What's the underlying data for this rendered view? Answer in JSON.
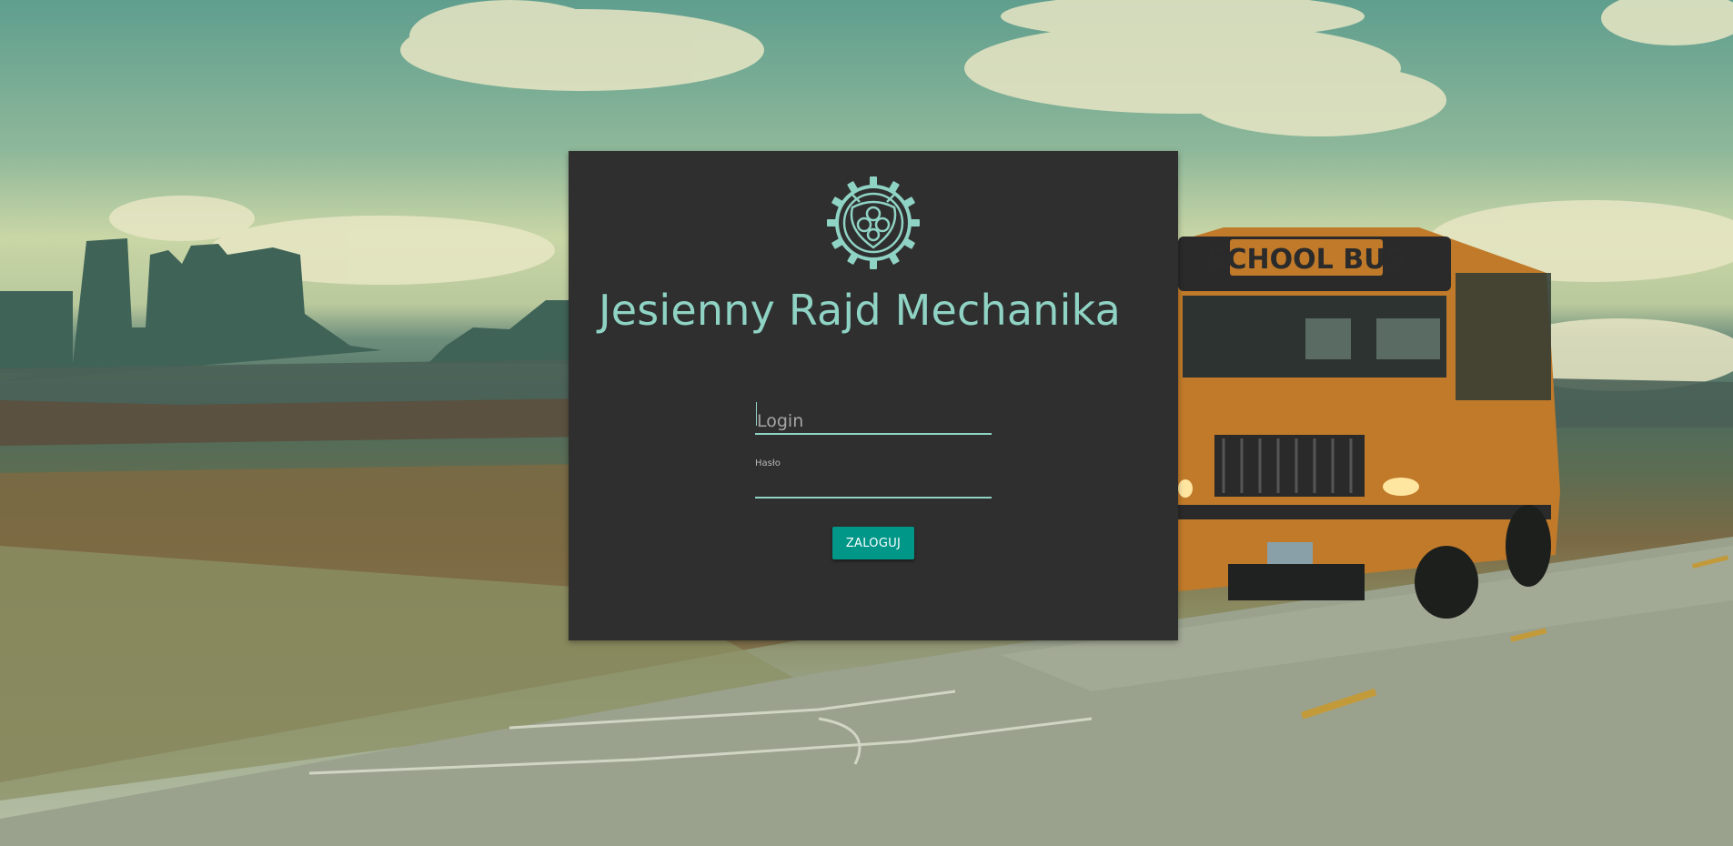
{
  "app": {
    "title": "Jesienny Rajd Mechanika",
    "logo_icon": "gear-emblem-icon",
    "accent_color": "#8fd3c4",
    "button_color": "#009688",
    "card_color": "#2f2f2f"
  },
  "form": {
    "login": {
      "placeholder": "Login",
      "value": ""
    },
    "password": {
      "label": "Hasło",
      "value": ""
    },
    "submit_label": "ZALOGUJ"
  },
  "background": {
    "bus_sign": "SCHOOL BUS"
  }
}
